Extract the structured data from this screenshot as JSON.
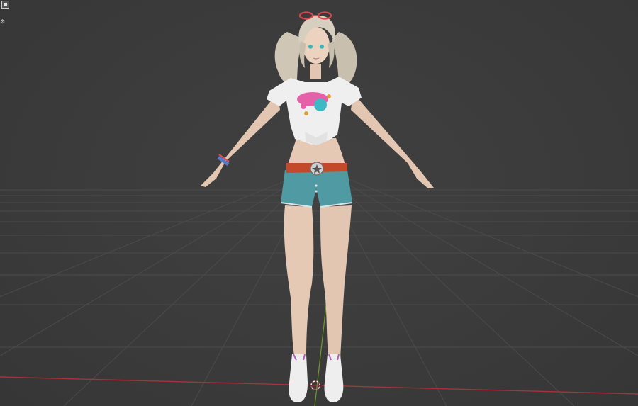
{
  "viewport": {
    "background_color": "#3a3a3a",
    "grid_color": "#4a4a4a",
    "x_axis_color": "#a8313d",
    "y_axis_color": "#6f9a2a"
  },
  "overlay": {
    "top_left_button_icon": "viewport-toggle-icon",
    "cursor_icon": "3d-cursor-icon",
    "side_icon": "view-options-icon"
  },
  "scene_object": {
    "type": "character-model",
    "pose": "T-pose",
    "outfit_colors": {
      "hair": "#cfc6b6",
      "shirt": "#efefef",
      "shorts": "#4f9aa3",
      "belt": "#c24a2a",
      "skin": "#e6c9b4",
      "shoes": "#eeeeee",
      "shoe_accent": "#b05fb8",
      "glasses": "#d6474d"
    }
  }
}
